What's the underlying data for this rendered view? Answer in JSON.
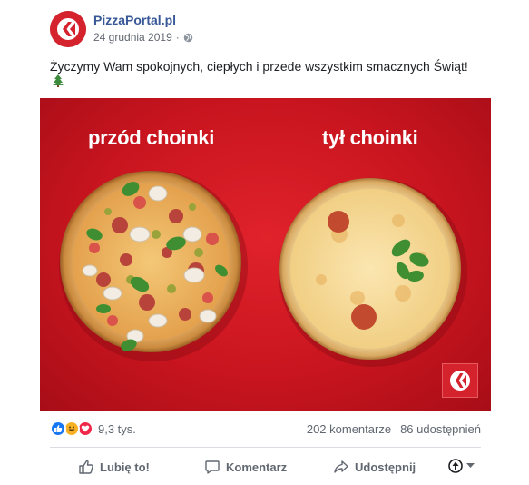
{
  "post": {
    "page_name": "PizzaPortal.pl",
    "date": "24 grudnia 2019",
    "separator": "·",
    "text": "Życzymy Wam spokojnych, ciepłych i przede wszystkim smacznych Świąt!",
    "emoji_icon": "christmas-tree-icon"
  },
  "image": {
    "label_front": "przód choinki",
    "label_back": "tył choinki"
  },
  "engagement": {
    "reactions": [
      "like",
      "haha",
      "love"
    ],
    "reaction_count": "9,3 tys.",
    "comments": "202 komentarze",
    "shares": "86 udostępnień"
  },
  "actions": {
    "like": "Lubię to!",
    "comment": "Komentarz",
    "share": "Udostępnij"
  },
  "colors": {
    "brand_red": "#d4232d",
    "link_blue": "#385898",
    "like_blue": "#1877f2",
    "haha_yellow": "#f7b125",
    "love_red": "#f0284a",
    "muted_text": "#606770"
  }
}
